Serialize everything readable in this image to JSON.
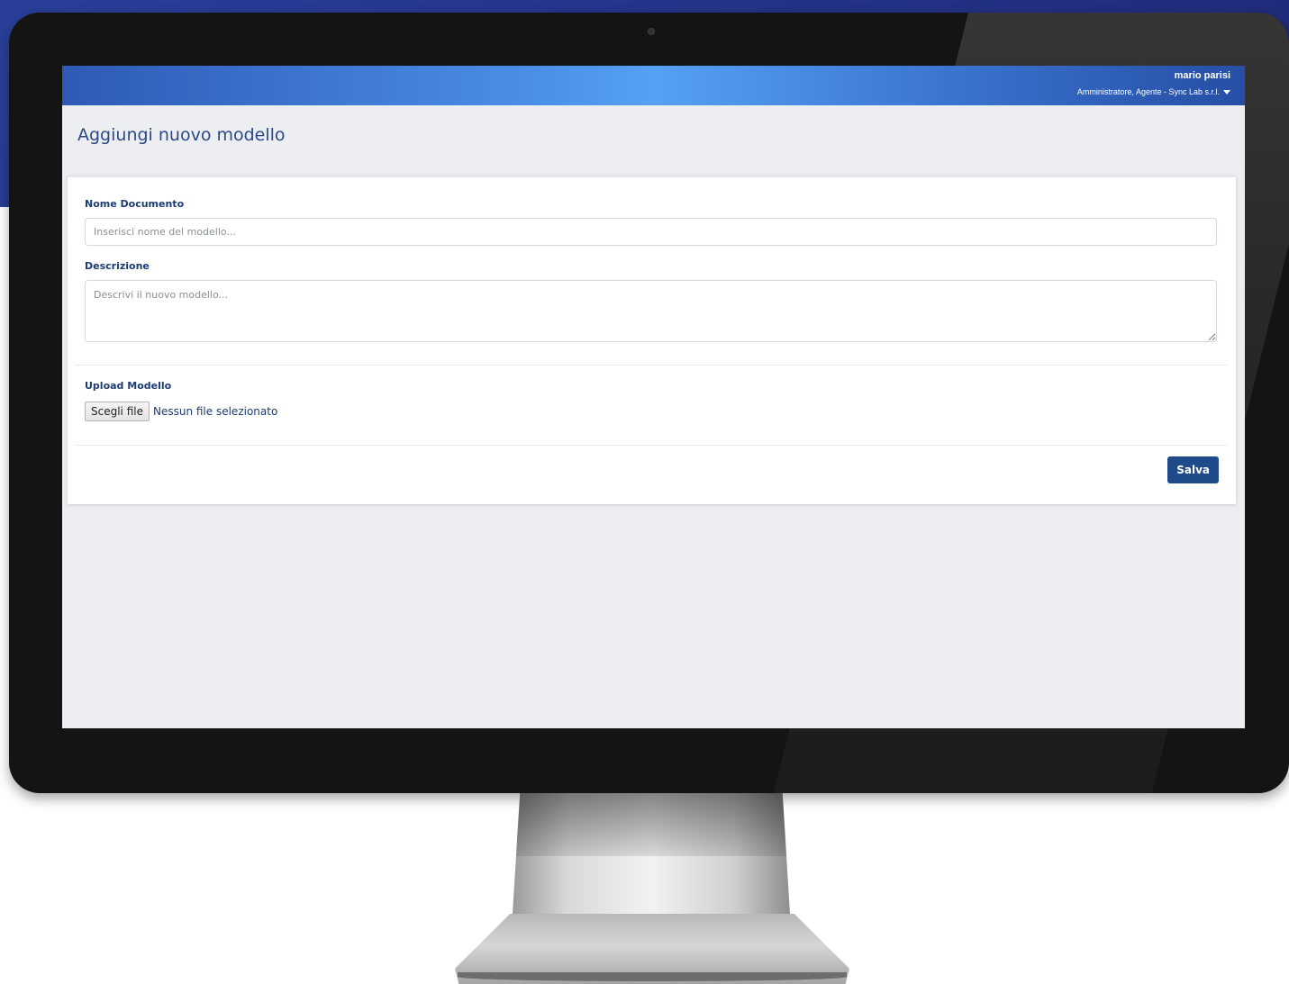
{
  "header": {
    "user_name": "mario parisi",
    "user_role": "Amministratore, Agente - Sync Lab s.r.l."
  },
  "page": {
    "title": "Aggiungi nuovo modello"
  },
  "form": {
    "nome_documento_label": "Nome Documento",
    "nome_documento_placeholder": "Inserisci nome del modello...",
    "nome_documento_value": "",
    "descrizione_label": "Descrizione",
    "descrizione_placeholder": "Descrivi il nuovo modello...",
    "descrizione_value": "",
    "upload_label": "Upload Modello",
    "file_button_label": "Scegli file",
    "file_status": "Nessun file selezionato",
    "save_label": "Salva"
  },
  "colors": {
    "accent": "#1f4b8a",
    "title": "#2b4a85",
    "background": "#eceef2"
  }
}
